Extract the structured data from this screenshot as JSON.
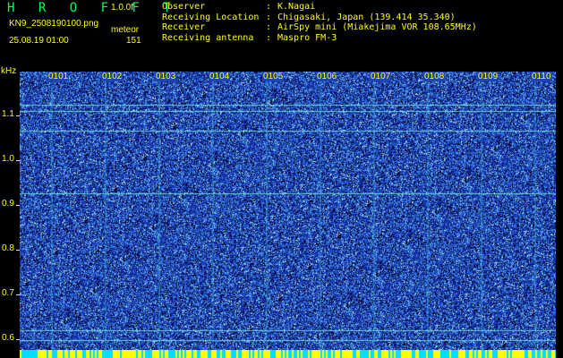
{
  "header": {
    "app_title": "H R O F F T",
    "version": "1.0.0f",
    "file_name": "KN9_2508190100.png",
    "meteor_label": "meteor",
    "meteor_count": "151",
    "date_time": "25.08.19 01:00"
  },
  "station_info": [
    {
      "key": "Observer",
      "value": "K.Nagai"
    },
    {
      "key": "Receiving Location",
      "value": "Chigasaki, Japan (139.414 35.340)"
    },
    {
      "key": "Receiver",
      "value": "AirSpy mini (Miakejima VOR 108.65MHz)"
    },
    {
      "key": "Receiving antenna",
      "value": "Maspro FM-3"
    }
  ],
  "axis": {
    "y_unit": "kHz",
    "y_ticks": [
      "1.1",
      "1.0",
      "0.9",
      "0.8",
      "0.7",
      "0.6"
    ],
    "x_ticks": [
      "0101",
      "0102",
      "0103",
      "0104",
      "0105",
      "0106",
      "0107",
      "0108",
      "0109",
      "0110"
    ]
  },
  "colors": {
    "background": "#000000",
    "text": "#ffff00",
    "title": "#00ff55",
    "spectrum_base": "#1c46b4"
  }
}
